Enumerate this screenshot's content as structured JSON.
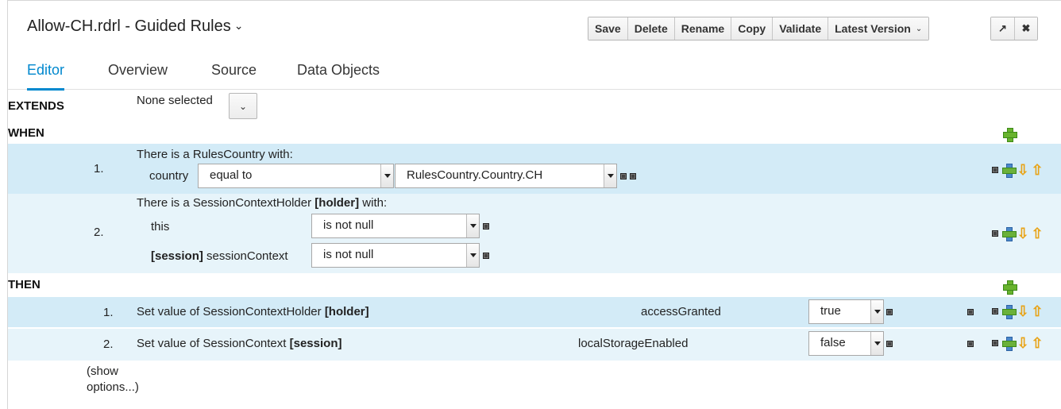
{
  "header": {
    "title": "Allow-CH.rdrl - Guided Rules",
    "toolbar": {
      "save": "Save",
      "delete": "Delete",
      "rename": "Rename",
      "copy": "Copy",
      "validate": "Validate",
      "latest_version": "Latest Version"
    }
  },
  "tabs": [
    "Editor",
    "Overview",
    "Source",
    "Data Objects"
  ],
  "active_tab": "Editor",
  "extends": {
    "label": "EXTENDS",
    "value": "None selected"
  },
  "when": {
    "label": "WHEN",
    "conditions": [
      {
        "number": "1.",
        "header_pre": "There is a RulesCountry with:",
        "field": "country",
        "operator": "equal to",
        "value": "RulesCountry.Country.CH"
      },
      {
        "number": "2.",
        "header_pre": "There is a SessionContextHolder ",
        "header_bold": "[holder]",
        "header_post": " with:",
        "fields": [
          {
            "name": "this",
            "operator": "is not null"
          },
          {
            "bold": "[session]",
            "name": " sessionContext",
            "operator": "is not null"
          }
        ]
      }
    ]
  },
  "then": {
    "label": "THEN",
    "actions": [
      {
        "number": "1.",
        "text": "Set value of SessionContextHolder ",
        "bold": "[holder]",
        "field": "accessGranted",
        "value": "true"
      },
      {
        "number": "2.",
        "text": "Set value of SessionContext ",
        "bold": "[session]",
        "field": "localStorageEnabled",
        "value": "false"
      }
    ]
  },
  "show_options": {
    "line1": "(show",
    "line2": "options...)"
  },
  "colors": {
    "accent": "#0088ce",
    "row_dark": "#d3ebf7",
    "row_light": "#e7f4fa"
  }
}
